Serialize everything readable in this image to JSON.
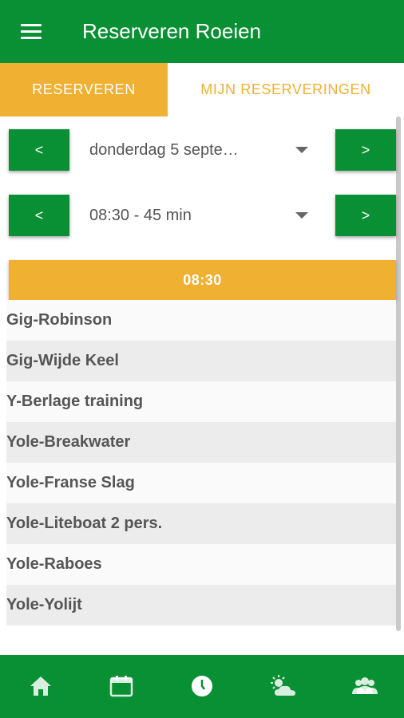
{
  "appbar": {
    "title": "Reserveren Roeien",
    "menu_icon": "menu-icon"
  },
  "tabs": [
    {
      "label": "RESERVEREN",
      "active": true
    },
    {
      "label": "MIJN RESERVERINGEN",
      "active": false
    }
  ],
  "date_row": {
    "prev": "<",
    "next": ">",
    "value": "donderdag 5 septe…"
  },
  "time_row": {
    "prev": "<",
    "next": ">",
    "value": "08:30 - 45 min"
  },
  "time_header": "08:30",
  "boats": [
    "Gig-Robinson",
    "Gig-Wijde Keel",
    "Y-Berlage training",
    "Yole-Breakwater",
    "Yole-Franse Slag",
    "Yole-Liteboat 2 pers.",
    "Yole-Raboes",
    "Yole-Yolijt"
  ],
  "bottom_nav": [
    "home-icon",
    "calendar-icon",
    "clock-icon",
    "weather-icon",
    "people-icon"
  ],
  "colors": {
    "primary": "#0a9034",
    "accent": "#f0b032"
  }
}
